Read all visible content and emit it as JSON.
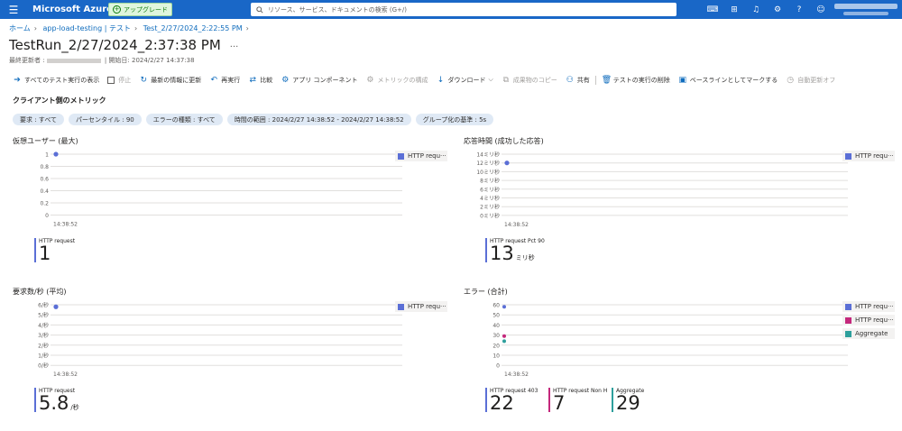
{
  "topbar": {
    "brand": "Microsoft Azure",
    "upgrade_label": "アップグレード",
    "search_placeholder": "リソース、サービス、ドキュメントの検索 (G+/)"
  },
  "breadcrumb": [
    "ホーム",
    "app-load-testing | テスト",
    "Test_2/27/2024_2:22:55 PM"
  ],
  "page": {
    "title": "TestRun_2/27/2024_2:37:38 PM",
    "more": "···",
    "last_updated_label": "最終更新者 :",
    "start_date": "| 開始日: 2024/2/27 14:37:38"
  },
  "toolbar": [
    {
      "label": "すべてのテスト実行の表示",
      "icon": "arrow-circle-icon",
      "glyph": "➔",
      "enabled": true
    },
    {
      "label": "停止",
      "icon": "stop-checkbox-icon",
      "glyph": "",
      "enabled": false
    },
    {
      "label": "最新の情報に更新",
      "icon": "refresh-icon",
      "glyph": "↻",
      "enabled": true
    },
    {
      "label": "再実行",
      "icon": "rerun-icon",
      "glyph": "↶",
      "enabled": true
    },
    {
      "label": "比較",
      "icon": "compare-icon",
      "glyph": "⇄",
      "enabled": true
    },
    {
      "label": "アプリ コンポーネント",
      "icon": "app-components-icon",
      "glyph": "⚙",
      "enabled": true
    },
    {
      "label": "メトリックの構成",
      "icon": "metrics-config-icon",
      "glyph": "⚙",
      "enabled": false
    },
    {
      "label": "ダウンロード",
      "icon": "download-icon",
      "glyph": "↓",
      "enabled": true,
      "chevron": "⌵"
    },
    {
      "label": "成果物のコピー",
      "icon": "copy-icon",
      "glyph": "⧉",
      "enabled": false
    },
    {
      "label": "共有",
      "icon": "share-icon",
      "glyph": "⚇",
      "enabled": true
    },
    {
      "label": "テストの実行の削除",
      "icon": "delete-icon",
      "glyph": "🗑",
      "enabled": true
    },
    {
      "label": "ベースラインとしてマークする",
      "icon": "baseline-icon",
      "glyph": "▣",
      "enabled": true
    },
    {
      "label": "自動更新オフ",
      "icon": "clock-icon",
      "glyph": "◷",
      "enabled": false
    }
  ],
  "section_title": "クライアント側のメトリック",
  "filters": [
    "要求 : すべて",
    "パーセンタイル : 90",
    "エラーの種類 : すべて",
    "時間の範囲 : 2024/2/27 14:38:52 - 2024/2/27 14:38:52",
    "グループ化の基準 : 5s"
  ],
  "colors": {
    "accent": "#0f6cbd",
    "series_blue": "#5b6fd6",
    "series_pink": "#c4287c",
    "series_teal": "#2d9f9c"
  },
  "charts": [
    {
      "title": "仮想ユーザー (最大)",
      "chart_data": {
        "type": "scatter",
        "x": [
          "14:38:52"
        ],
        "y_ticks": [
          "1",
          "0.8",
          "0.6",
          "0.4",
          "0.2",
          "0"
        ],
        "ylim": [
          0,
          1
        ],
        "series": [
          {
            "name": "HTTP requ···",
            "color": "#5b6fd6",
            "values": [
              1
            ]
          }
        ]
      },
      "stats": [
        {
          "label": "HTTP request",
          "value": "1",
          "unit": "",
          "color": "#5b6fd6"
        }
      ]
    },
    {
      "title": "応答時間 (成功した応答)",
      "chart_data": {
        "type": "scatter",
        "x": [
          "14:38:52"
        ],
        "y_ticks": [
          "14ミリ秒",
          "12ミリ秒",
          "10ミリ秒",
          "8ミリ秒",
          "6ミリ秒",
          "4ミリ秒",
          "2ミリ秒",
          "0ミリ秒"
        ],
        "ylim": [
          0,
          14
        ],
        "series": [
          {
            "name": "HTTP requ···",
            "color": "#5b6fd6",
            "values": [
              12
            ]
          }
        ]
      },
      "stats": [
        {
          "label": "HTTP request Pct 90",
          "value": "13",
          "unit": "ミリ秒",
          "color": "#5b6fd6"
        }
      ]
    },
    {
      "title": "要求数/秒 (平均)",
      "chart_data": {
        "type": "scatter",
        "x": [
          "14:38:52"
        ],
        "y_ticks": [
          "6/秒",
          "5/秒",
          "4/秒",
          "3/秒",
          "2/秒",
          "1/秒",
          "0/秒"
        ],
        "ylim": [
          0,
          6
        ],
        "series": [
          {
            "name": "HTTP requ···",
            "color": "#5b6fd6",
            "values": [
              5.8
            ]
          }
        ]
      },
      "stats": [
        {
          "label": "HTTP request",
          "value": "5.8",
          "unit": "/秒",
          "color": "#5b6fd6"
        }
      ]
    },
    {
      "title": "エラー (合計)",
      "chart_data": {
        "type": "scatter",
        "x": [
          "14:38:52"
        ],
        "y_ticks": [
          "60",
          "50",
          "40",
          "30",
          "20",
          "10",
          "0"
        ],
        "ylim": [
          0,
          60
        ],
        "series": [
          {
            "name": "HTTP requ···",
            "color": "#5b6fd6",
            "values": [
              58
            ]
          },
          {
            "name": "HTTP requ···",
            "color": "#c4287c",
            "values": [
              29
            ]
          },
          {
            "name": "Aggregate",
            "color": "#2d9f9c",
            "values": [
              24
            ]
          }
        ]
      },
      "stats": [
        {
          "label": "HTTP request 403",
          "value": "22",
          "unit": "",
          "color": "#5b6fd6"
        },
        {
          "label": "HTTP request Non H···",
          "value": "7",
          "unit": "",
          "color": "#c4287c"
        },
        {
          "label": "Aggregate",
          "value": "29",
          "unit": "",
          "color": "#2d9f9c"
        }
      ]
    }
  ]
}
